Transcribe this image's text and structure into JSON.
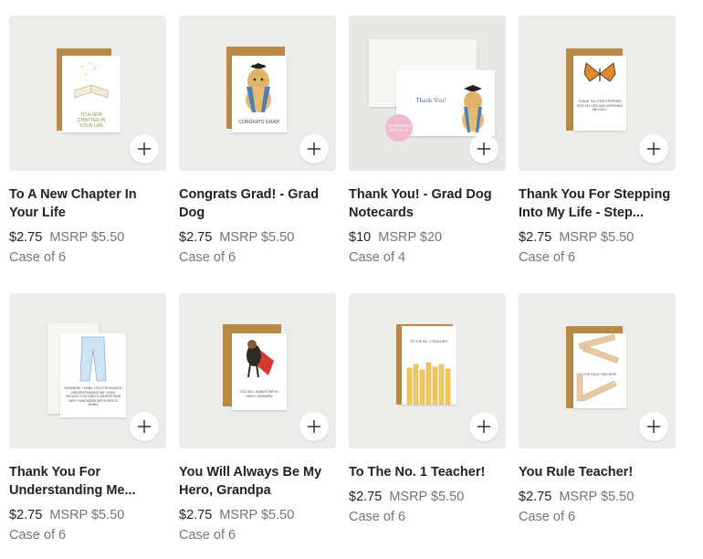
{
  "products": [
    {
      "title": "To A New Chapter In Your Life",
      "price": "$2.75",
      "msrp": "MSRP $5.50",
      "case": "Case of 6",
      "card_text": "TO A NEW CHAPTER IN YOUR LIFE"
    },
    {
      "title": "Congrats Grad! - Grad Dog",
      "price": "$2.75",
      "msrp": "MSRP $5.50",
      "case": "Case of 6",
      "card_text": "CONGRATS GRAD!"
    },
    {
      "title": "Thank You! - Grad Dog Notecards",
      "price": "$10",
      "msrp": "MSRP $20",
      "case": "Case of 4",
      "card_text": "Thank You!",
      "badge_text": "NOTECARDS SET OF 10"
    },
    {
      "title": "Thank You For Stepping Into My Life - Step...",
      "price": "$2.75",
      "msrp": "MSRP $5.50",
      "case": "Case of 6",
      "card_text": "THANK YOU FOR STEPPING INTO MY LIFE AND INSPIRING ME DAILY"
    },
    {
      "title": "Thank You For Understanding Me...",
      "price": "$2.75",
      "msrp": "MSRP $5.50",
      "case": "Case of 6",
      "card_text": "MOMMOM, THANK YOU FOR ALWAYS UNDERSTANDING ME, EVEN THOUGH YOU DIDN'T UNDERSTAND WHY I WAS BORN WITH RIPS IN JEANS"
    },
    {
      "title": "You Will Always Be My Hero, Grandpa",
      "price": "$2.75",
      "msrp": "MSRP $5.50",
      "case": "Case of 6",
      "card_text": "YOU WILL ALWAYS BE MY HERO, GRANDPA"
    },
    {
      "title": "To The No. 1 Teacher!",
      "price": "$2.75",
      "msrp": "MSRP $5.50",
      "case": "Case of 6",
      "card_text": "TO THE NO. 1 TEACHER!"
    },
    {
      "title": "You Rule Teacher!",
      "price": "$2.75",
      "msrp": "MSRP $5.50",
      "case": "Case of 6",
      "card_text": "YOU RULE TEACHER!"
    }
  ],
  "colors": {
    "background": "#ffffff",
    "thumb_bg": "#ececea",
    "envelope": "#b98a45",
    "muted_text": "#757575",
    "primary_text": "#222222"
  },
  "icons": {
    "add": "plus-icon"
  }
}
